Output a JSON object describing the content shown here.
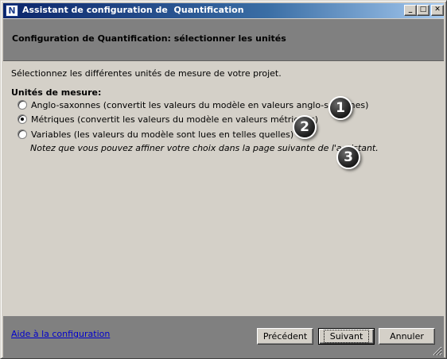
{
  "titlebar": {
    "icon_letter": "N",
    "title": "Assistant de configuration de  Quantification",
    "minimize": "_",
    "maximize": "□",
    "close": "✕"
  },
  "header": {
    "title": "Configuration de Quantification: sélectionner les unités"
  },
  "content": {
    "intro": "Sélectionnez les différentes unités de mesure de votre projet.",
    "group_label": "Unités de mesure:",
    "options": [
      {
        "label": "Anglo-saxonnes (convertit les valeurs du modèle en valeurs anglo-saxonnes)",
        "checked": false
      },
      {
        "label": "Métriques (convertit les valeurs du modèle en valeurs métriques)",
        "checked": true
      },
      {
        "label": "Variables (les valeurs du modèle sont lues en telles quelles)",
        "checked": false
      }
    ],
    "note": "Notez que vous pouvez affiner votre choix dans la page suivante de l'assistant.",
    "callouts": [
      "1",
      "2",
      "3"
    ]
  },
  "footer": {
    "help_link": "Aide à la configuration",
    "previous": "Précédent",
    "next": "Suivant",
    "cancel": "Annuler"
  }
}
